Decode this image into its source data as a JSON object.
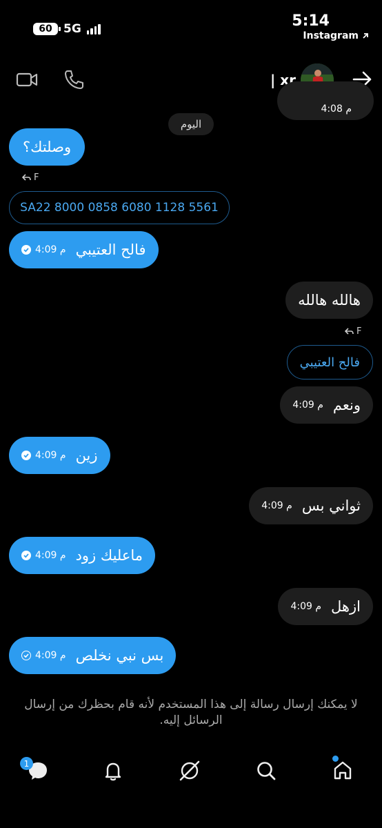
{
  "status": {
    "battery": "60",
    "network": "5G",
    "time": "5:14",
    "back_app": "Instagram"
  },
  "header": {
    "username": "| xr",
    "icons": [
      "video-icon",
      "phone-icon",
      "back-arrow-icon"
    ]
  },
  "conversation": {
    "partial_top": {
      "time": "4:08 م"
    },
    "date_label": "اليوم",
    "messages": [
      {
        "text": "وصلتك؟",
        "side": "mine"
      },
      {
        "reply_label": "F"
      },
      {
        "text": "SA22 8000 0858 6080 1128 5561",
        "side": "mine-outline"
      },
      {
        "text": "فالح العتيبي",
        "time": "4:09 م",
        "side": "mine"
      },
      {
        "text": "هالله هالله",
        "side": "theirs"
      },
      {
        "reply_label": "F"
      },
      {
        "text": "فالح العتيبي",
        "side": "theirs-outline"
      },
      {
        "text": "ونعم",
        "time": "4:09 م",
        "side": "theirs"
      },
      {
        "text": "زين",
        "time": "4:09 م",
        "side": "mine"
      },
      {
        "text": "ثواني بس",
        "time": "4:09 م",
        "side": "theirs"
      },
      {
        "text": "ماعليك زود",
        "time": "4:09 م",
        "side": "mine"
      },
      {
        "text": "ازهل",
        "time": "4:09 م",
        "side": "theirs"
      },
      {
        "text": "بس نبي نخلص",
        "time": "4:09 م",
        "side": "mine"
      }
    ]
  },
  "blocked_notice": "لا يمكنك إرسال رسالة إلى هذا المستخدم لأنه قام بحظرك من إرسال الرسائل إليه.",
  "tabbar": {
    "messages_badge": "1",
    "items": [
      "messages-icon",
      "notifications-icon",
      "explore-icon",
      "search-icon",
      "home-icon"
    ]
  },
  "colors": {
    "accent": "#2d9cf0",
    "bubble_theirs": "#1e1e1e",
    "background": "#000000"
  }
}
